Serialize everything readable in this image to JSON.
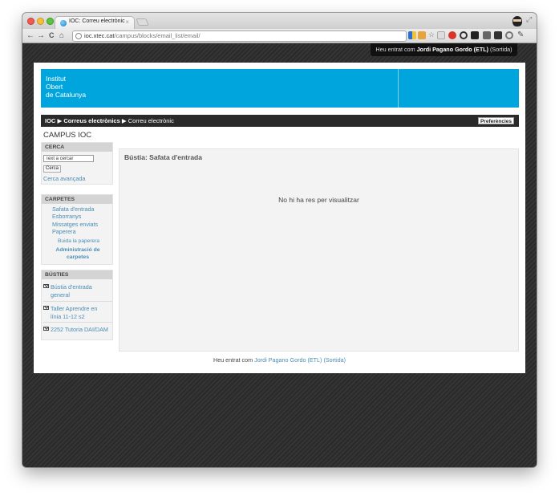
{
  "browser": {
    "tab_title": "IOC: Correu electrònic",
    "tab_close": "×",
    "url_host": "ioc.xtec.cat",
    "url_path": "/campus/blocks/email_list/email/",
    "nav": {
      "back": "←",
      "forward": "→",
      "reload": "C",
      "home": "⌂"
    }
  },
  "userbar": {
    "prefix": "Heu entrat com ",
    "user": "Jordi Pagano Gordo (ETL)",
    "logout": "(Sortida)"
  },
  "banner": {
    "line1": "Institut",
    "line2": "Obert",
    "line3": "de Catalunya"
  },
  "breadcrumb": {
    "home": "IOC",
    "sep": "▶",
    "section": "Correus electrònics",
    "current": "Correu electrònic",
    "preferences": "Preferències"
  },
  "site_name": "CAMPUS IOC",
  "search_block": {
    "title": "CERCA",
    "input_value": "Text a cercar",
    "button": "Cerca",
    "advanced": "Cerca avançada"
  },
  "folders_block": {
    "title": "CARPETES",
    "items": [
      "Safata d'entrada",
      "Esborranys",
      "Missatges enviats",
      "Paperera"
    ],
    "empty_trash": "Buida la paperera",
    "admin_line1": "Administració de",
    "admin_line2": "carpetes"
  },
  "mailboxes_block": {
    "title": "BÚSTIES",
    "items": [
      {
        "line1": "Bústia d'entrada",
        "line2": "general"
      },
      {
        "line1": "Taller Aprendre en",
        "line2": "línia 11-12 s2"
      },
      {
        "line1": "2252 Tutoria DAI/DAM",
        "line2": ""
      }
    ]
  },
  "main": {
    "title": "Bústia: Safata d'entrada",
    "empty_message": "No hi ha res per visualitzar"
  },
  "footer": {
    "prefix": "Heu entrat com ",
    "user": "Jordi Pagano Gordo (ETL)",
    "logout": "(Sortida)"
  },
  "colors": {
    "banner": "#00a5de",
    "link": "#4a8db5",
    "dark_bar": "#2a2a2a"
  }
}
